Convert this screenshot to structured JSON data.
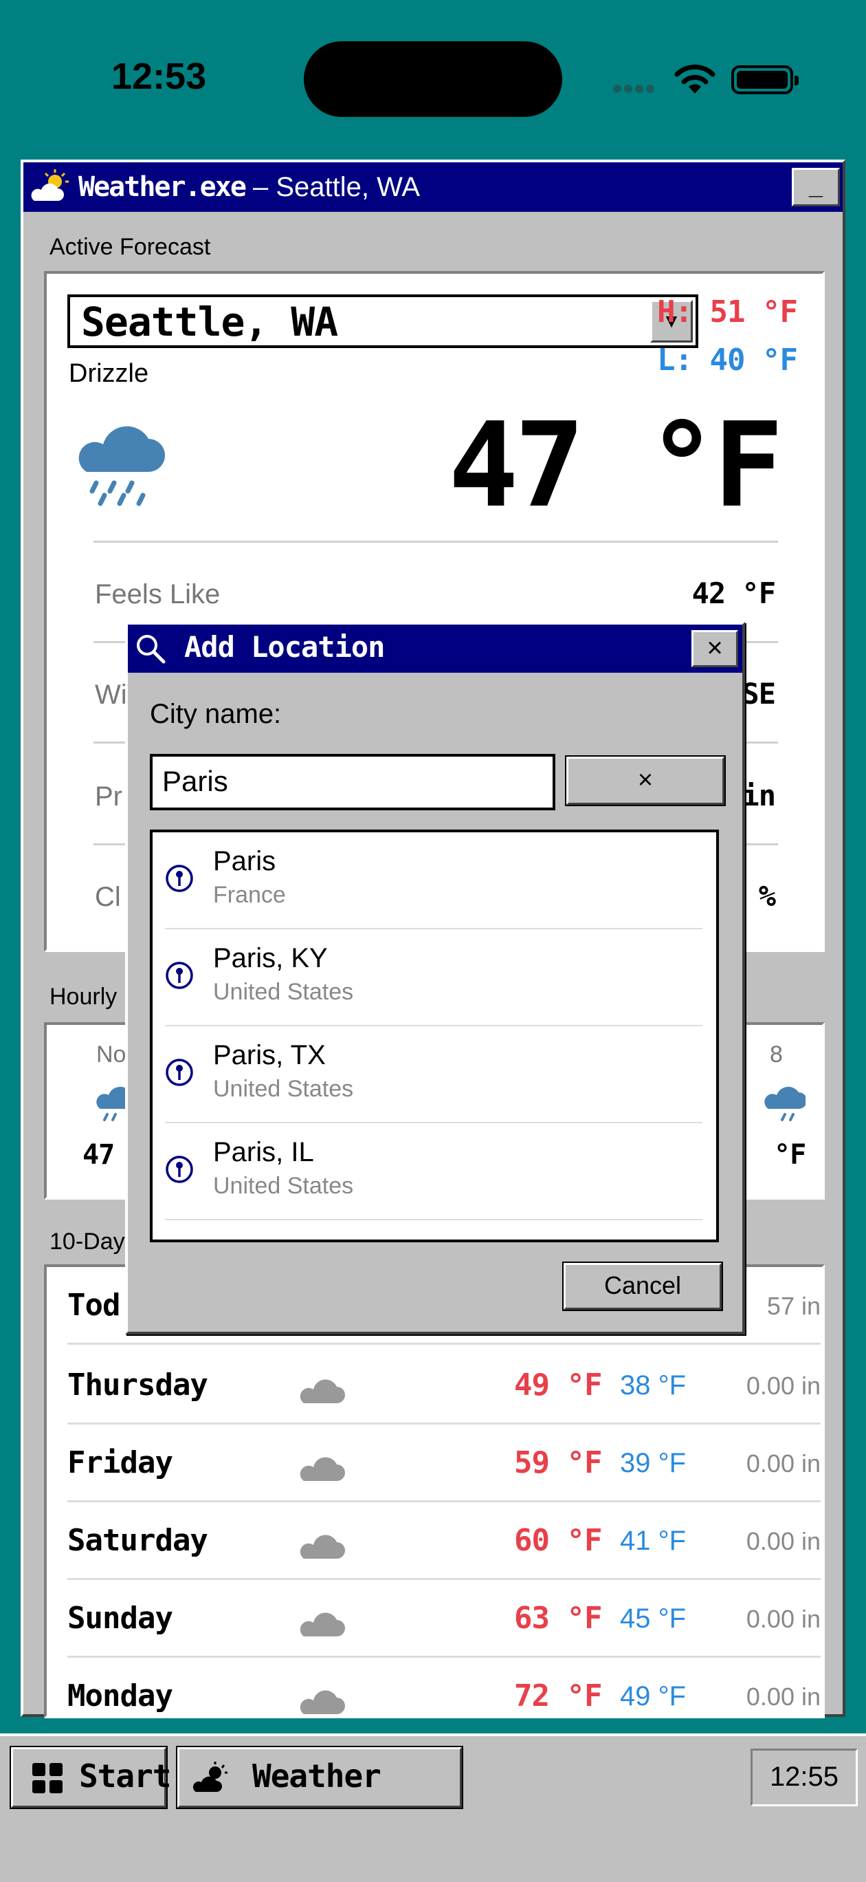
{
  "status": {
    "time": "12:53"
  },
  "window": {
    "app_name": "Weather.exe",
    "location_suffix": " – Seattle, WA",
    "minimize_label": "_"
  },
  "active": {
    "section_label": "Active Forecast",
    "city": "Seattle, WA",
    "dropdown_arrow": "▼",
    "condition": "Drizzle",
    "high": "H: 51 °F",
    "low": "L: 40 °F",
    "temp": "47 °F",
    "weather_icon": "cloud-rain-icon",
    "details": [
      {
        "label": "Feels Like",
        "value": "42 °F"
      },
      {
        "label": "Wi",
        "value": "SE"
      },
      {
        "label": "Pr",
        "value": "in"
      },
      {
        "label": "Cl",
        "value": "%"
      }
    ]
  },
  "hourly": {
    "section_label": "Hourly",
    "left": {
      "time": "No",
      "temp": "47"
    },
    "right": {
      "time": "8",
      "temp": "°F"
    }
  },
  "tenday": {
    "section_label": "10-Day",
    "rows": [
      {
        "day": "Tod",
        "high": "",
        "low": "",
        "precip": "57 in",
        "icon": ""
      },
      {
        "day": "Thursday",
        "high": "49 °F",
        "low": "38 °F",
        "precip": "0.00 in",
        "icon": "cloud-icon"
      },
      {
        "day": "Friday",
        "high": "59 °F",
        "low": "39 °F",
        "precip": "0.00 in",
        "icon": "cloud-icon"
      },
      {
        "day": "Saturday",
        "high": "60 °F",
        "low": "41 °F",
        "precip": "0.00 in",
        "icon": "cloud-icon"
      },
      {
        "day": "Sunday",
        "high": "63 °F",
        "low": "45 °F",
        "precip": "0.00 in",
        "icon": "cloud-icon"
      },
      {
        "day": "Monday",
        "high": "72 °F",
        "low": "49 °F",
        "precip": "0.00 in",
        "icon": "cloud-icon"
      }
    ]
  },
  "dialog": {
    "title": "Add Location",
    "close_label": "×",
    "city_label": "City name:",
    "input_value": "Paris",
    "clear_label": "×",
    "results": [
      {
        "name": "Paris",
        "country": "France"
      },
      {
        "name": "Paris, KY",
        "country": "United States"
      },
      {
        "name": "Paris, TX",
        "country": "United States"
      },
      {
        "name": "Paris, IL",
        "country": "United States"
      }
    ],
    "cancel_label": "Cancel"
  },
  "taskbar": {
    "start_label": "Start",
    "app_label": "Weather",
    "clock": "12:55"
  },
  "colors": {
    "teal": "#008080",
    "navy": "#000080",
    "high": "#e8404a",
    "low": "#2a8ae0",
    "rain_cloud": "#4682b4"
  }
}
